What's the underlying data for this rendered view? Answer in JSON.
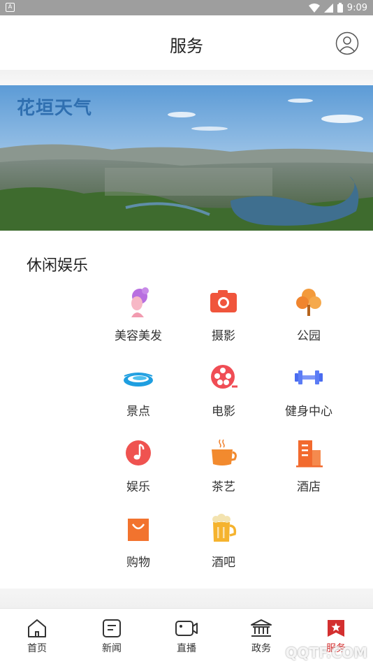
{
  "status_bar": {
    "time": "9:09",
    "icons": [
      "app-notification-icon",
      "wifi-icon",
      "signal-icon",
      "battery-icon"
    ]
  },
  "header": {
    "title": "服务",
    "avatar_icon": "user-avatar-icon"
  },
  "banner": {
    "text": "花垣天气"
  },
  "section": {
    "title": "休闲娱乐",
    "items": [
      {
        "label": "美容美发",
        "icon": "beauty-hair-icon"
      },
      {
        "label": "摄影",
        "icon": "camera-icon"
      },
      {
        "label": "公园",
        "icon": "park-tree-icon"
      },
      {
        "label": "景点",
        "icon": "scenic-lake-icon"
      },
      {
        "label": "电影",
        "icon": "film-reel-icon"
      },
      {
        "label": "健身中心",
        "icon": "dumbbell-icon"
      },
      {
        "label": "娱乐",
        "icon": "music-note-icon"
      },
      {
        "label": "茶艺",
        "icon": "tea-cup-icon"
      },
      {
        "label": "酒店",
        "icon": "hotel-building-icon"
      },
      {
        "label": "购物",
        "icon": "shopping-bag-icon"
      },
      {
        "label": "酒吧",
        "icon": "beer-mug-icon"
      }
    ]
  },
  "tab_bar": {
    "tabs": [
      {
        "label": "首页",
        "icon": "home-icon"
      },
      {
        "label": "新闻",
        "icon": "news-icon"
      },
      {
        "label": "直播",
        "icon": "video-camera-icon"
      },
      {
        "label": "政务",
        "icon": "government-building-icon"
      },
      {
        "label": "服务",
        "icon": "service-star-icon",
        "active": true
      }
    ]
  },
  "colors": {
    "accent": "#d32f2f",
    "status_bar": "#9e9e9e"
  },
  "watermark": "QQTF.COM"
}
